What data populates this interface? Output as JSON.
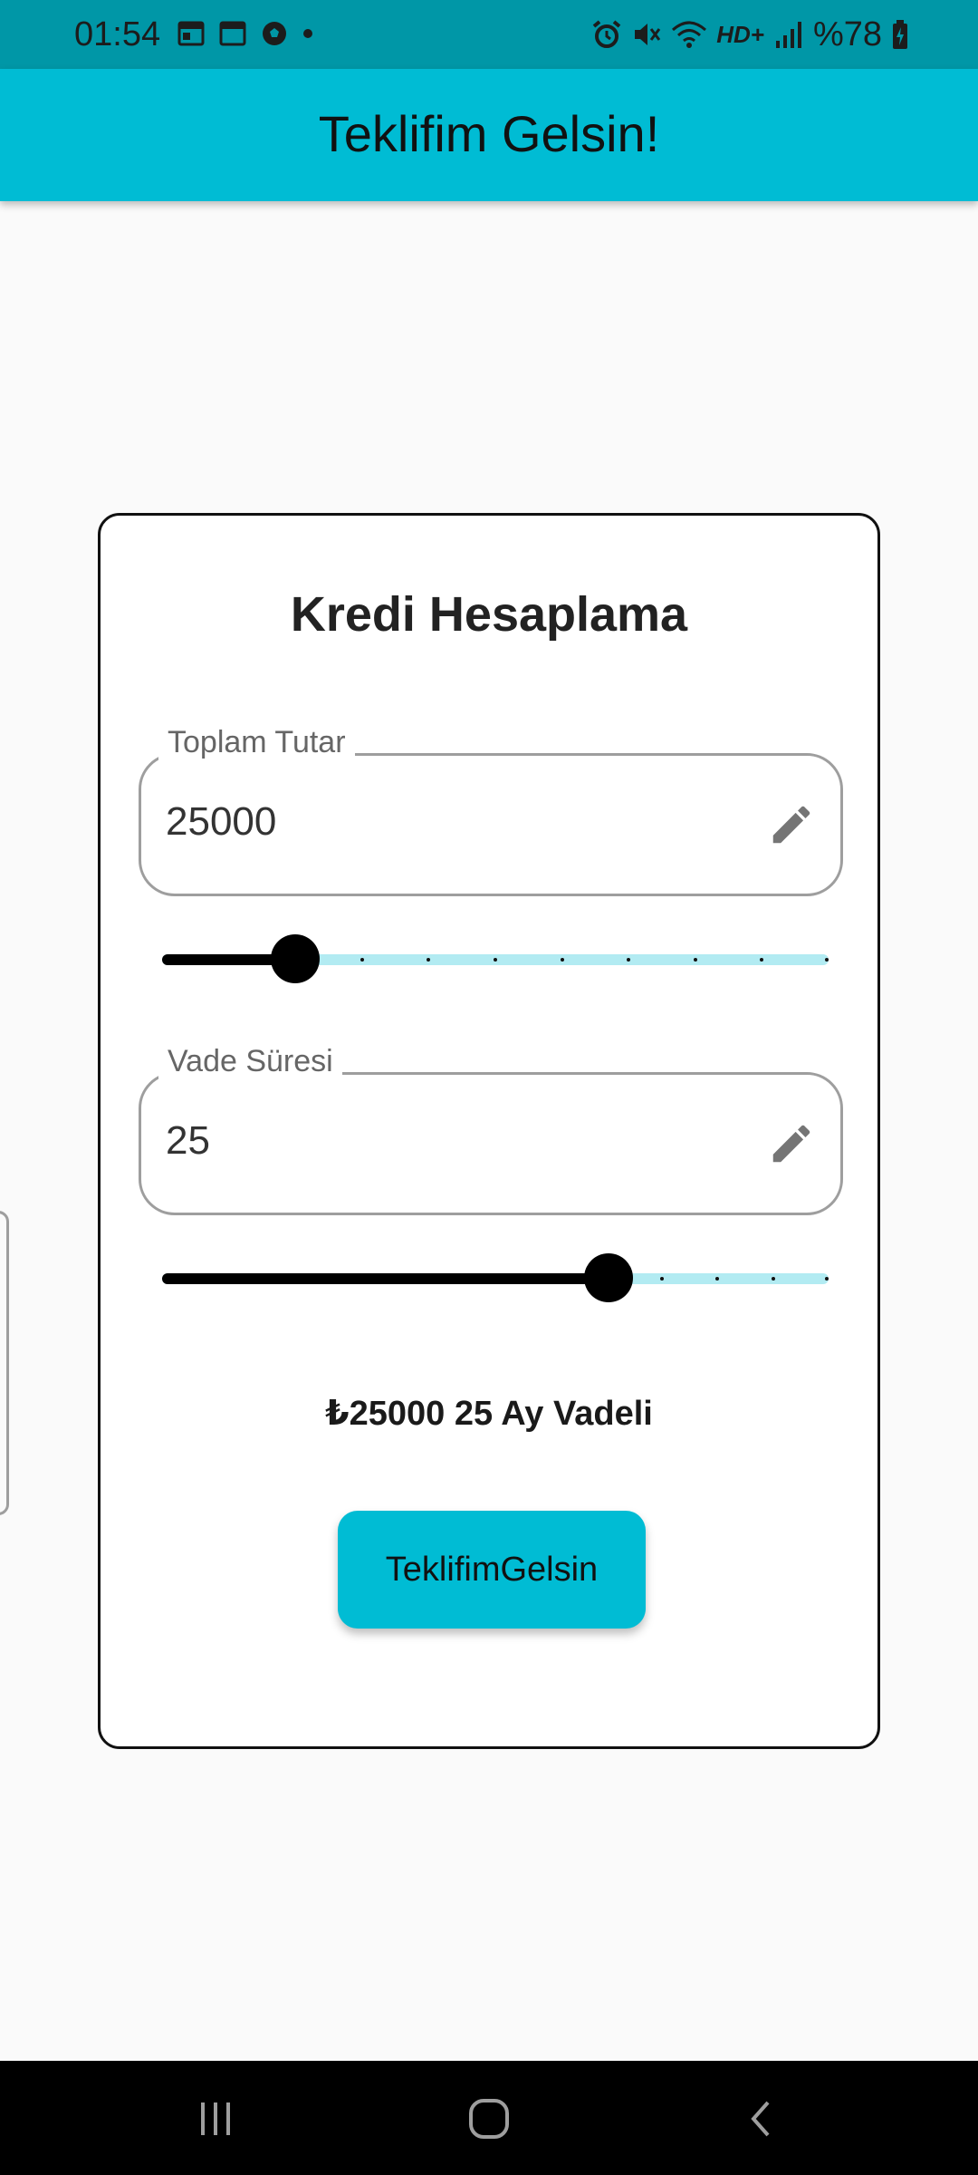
{
  "status_bar": {
    "time": "01:54",
    "network_label": "HD+",
    "battery_percent": "%78",
    "left_icons": [
      "calendar-icon",
      "calendar-icon",
      "soccer-ball-icon",
      "dot-icon"
    ],
    "right_icons": [
      "alarm-icon",
      "mute-icon",
      "wifi-icon",
      "signal-icon",
      "battery-charging-icon"
    ]
  },
  "app_bar": {
    "title": "Teklifim Gelsin!"
  },
  "card": {
    "title": "Kredi Hesaplama",
    "amount_field": {
      "label": "Toplam Tutar",
      "value": "25000",
      "icon": "edit-icon"
    },
    "amount_slider": {
      "value_fraction": 0.2,
      "divisions": 10
    },
    "term_field": {
      "label": "Vade Süresi",
      "value": "25",
      "icon": "edit-icon"
    },
    "term_slider": {
      "value_fraction": 0.67,
      "divisions": 12
    },
    "summary": "₺25000 25 Ay Vadeli",
    "submit_label": "TeklifimGelsin"
  },
  "nav_bar": {
    "icons": [
      "recent-apps-icon",
      "home-icon",
      "back-icon"
    ]
  },
  "colors": {
    "primary": "#00bcd4",
    "status_bar": "#0097a7",
    "slider_active": "#000000",
    "slider_inactive": "#b2ebf2"
  }
}
